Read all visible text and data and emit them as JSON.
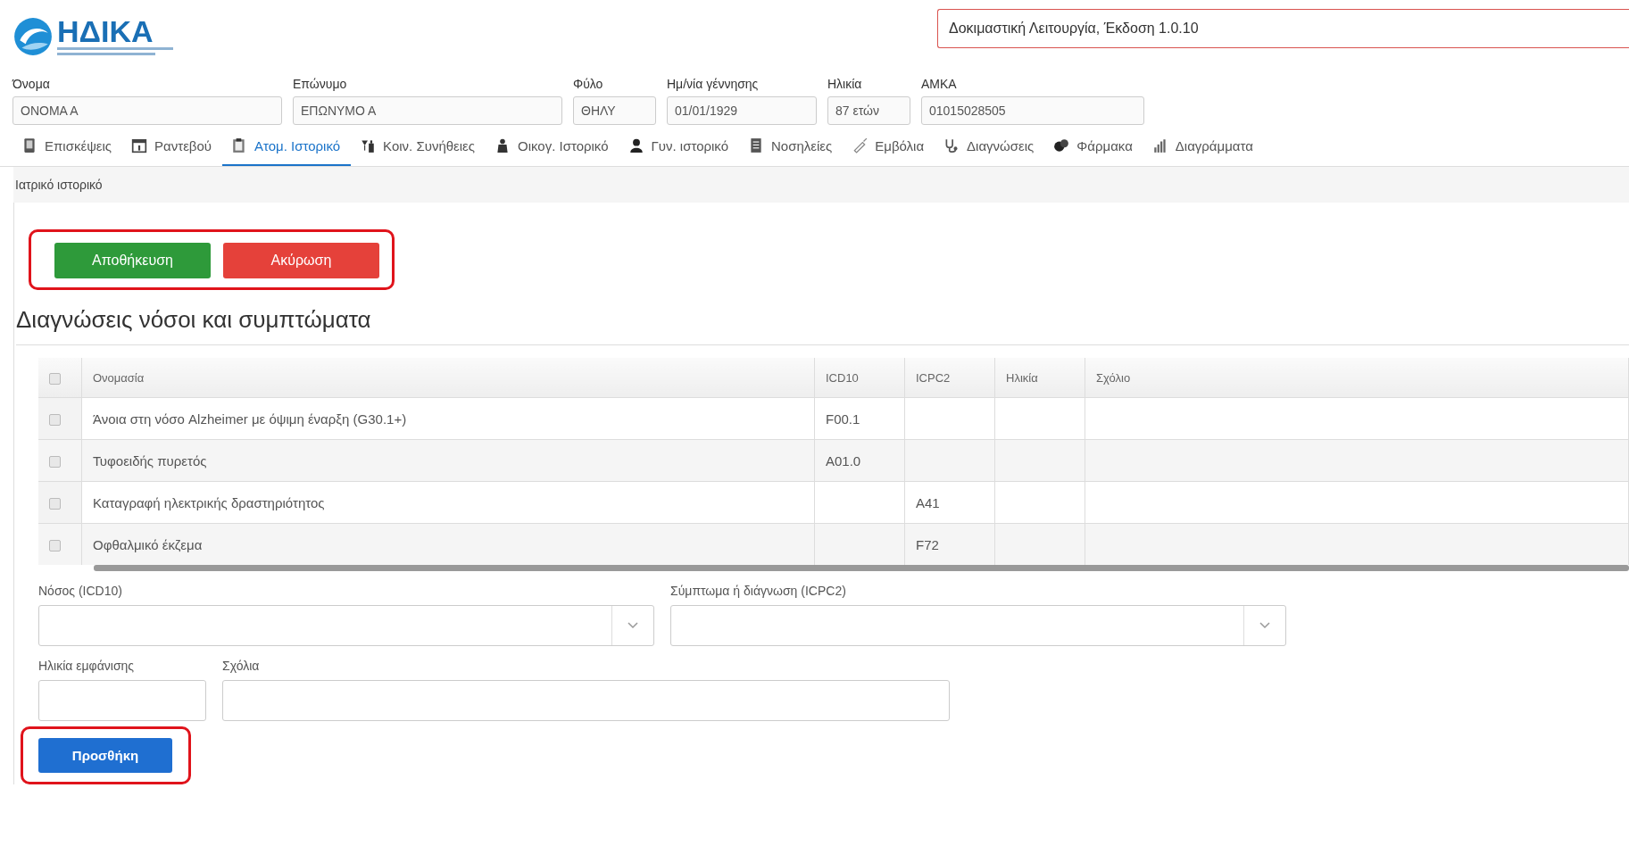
{
  "header": {
    "logo_text": "ΗΔΙΚΑ",
    "version_notice": "Δοκιμαστική Λειτουργία, Έκδοση 1.0.10"
  },
  "patient": [
    {
      "label": "Όνομα",
      "value": "ΟΝΟΜΑ Α"
    },
    {
      "label": "Επώνυμο",
      "value": "ΕΠΩΝΥΜΟ Α"
    },
    {
      "label": "Φύλο",
      "value": "ΘΗΛΥ"
    },
    {
      "label": "Ημ/νία γέννησης",
      "value": "01/01/1929"
    },
    {
      "label": "Ηλικία",
      "value": "87 ετών"
    },
    {
      "label": "ΑΜΚΑ",
      "value": "01015028505"
    }
  ],
  "tabs": [
    {
      "label": "Επισκέψεις",
      "selected": false
    },
    {
      "label": "Ραντεβού",
      "selected": false
    },
    {
      "label": "Ατομ. Ιστορικό",
      "selected": true
    },
    {
      "label": "Κοιν. Συνήθειες",
      "selected": false
    },
    {
      "label": "Οικογ. Ιστορικό",
      "selected": false
    },
    {
      "label": "Γυν. ιστορικό",
      "selected": false
    },
    {
      "label": "Νοσηλείες",
      "selected": false
    },
    {
      "label": "Εμβόλια",
      "selected": false
    },
    {
      "label": "Διαγνώσεις",
      "selected": false
    },
    {
      "label": "Φάρμακα",
      "selected": false
    },
    {
      "label": "Διαγράμματα",
      "selected": false
    }
  ],
  "panel": {
    "title": "Ιατρικό ιστορικό",
    "actions": {
      "highlighted": true,
      "buttons": [
        {
          "label": "Αποθήκευση",
          "kind": "success"
        },
        {
          "label": "Ακύρωση",
          "kind": "danger"
        }
      ]
    },
    "section_title": "Διαγνώσεις νόσοι και συμπτώματα",
    "table": {
      "all_checked": false,
      "columns": [
        "Ονομασία",
        "ICD10",
        "ICPC2",
        "Ηλικία",
        "Σχόλιο"
      ],
      "rows": [
        {
          "checked": false,
          "cells": [
            "Άνοια στη νόσο Alzheimer με όψιμη έναρξη (G30.1+)",
            "F00.1",
            "",
            "",
            ""
          ]
        },
        {
          "checked": false,
          "cells": [
            "Τυφοειδής πυρετός",
            "A01.0",
            "",
            "",
            ""
          ]
        },
        {
          "checked": false,
          "cells": [
            "Καταγραφή ηλεκτρικής δραστηριότητος",
            "",
            "A41",
            "",
            ""
          ]
        },
        {
          "checked": false,
          "cells": [
            "Οφθαλμικό έκζεμα",
            "",
            "F72",
            "",
            ""
          ]
        }
      ]
    },
    "form": {
      "disease_label": "Νόσος (ICD10)",
      "symptom_label": "Σύμπτωμα ή διάγνωση (ICPC2)",
      "onset_age_label": "Ηλικία εμφάνισης",
      "comments_label": "Σχόλια",
      "add_button": {
        "label": "Προσθήκη",
        "highlighted": true
      }
    }
  }
}
